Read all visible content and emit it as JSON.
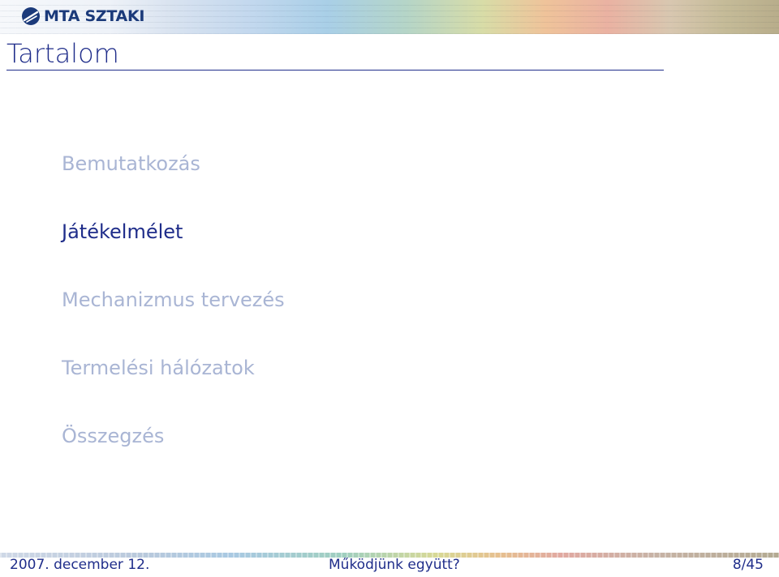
{
  "header": {
    "logo_text": "MTA SZTAKI",
    "logo_icon": "sztaki-logo-icon"
  },
  "frame": {
    "title": "Tartalom"
  },
  "toc": {
    "items": [
      {
        "label": "Bemutatkozás",
        "active": false
      },
      {
        "label": "Játékelmélet",
        "active": true
      },
      {
        "label": "Mechanizmus tervezés",
        "active": false
      },
      {
        "label": "Termelési hálózatok",
        "active": false
      },
      {
        "label": "Összegzés",
        "active": false
      }
    ]
  },
  "footer": {
    "date": "2007. december 12.",
    "title": "Működjünk együtt?",
    "page": "8/45"
  },
  "colors": {
    "title_blue": "#1f2d8a",
    "inactive_item": "#a9b5d4",
    "logo_blue": "#1b3a7a"
  }
}
